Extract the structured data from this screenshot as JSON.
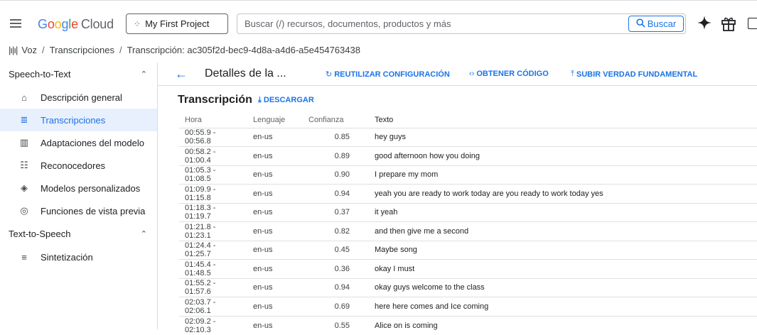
{
  "topbar": {
    "logo_parts": [
      "G",
      "o",
      "o",
      "g",
      "l",
      "e"
    ],
    "logo_suffix": "Cloud",
    "project": "My First Project",
    "search_placeholder": "Buscar (/) recursos, documentos, productos y más",
    "search_button": "Buscar",
    "icons": [
      "menu-icon",
      "project-dots-icon",
      "search-icon",
      "gemini-spark-icon",
      "gift-icon",
      "terminal-icon"
    ]
  },
  "breadcrumb": {
    "items": [
      "Voz",
      "Transcripciones",
      "Transcripción: ac305f2d-bec9-4d8a-a4d6-a5e454763438"
    ]
  },
  "sidebar": {
    "sections": [
      {
        "label": "Speech-to-Text",
        "items": [
          {
            "label": "Descripción general",
            "icon": "home-icon",
            "glyph": "⌂"
          },
          {
            "label": "Transcripciones",
            "icon": "transcriptions-icon",
            "glyph": "≣",
            "active": true
          },
          {
            "label": "Adaptaciones del modelo",
            "icon": "model-adaptation-icon",
            "glyph": "▥"
          },
          {
            "label": "Reconocedores",
            "icon": "recognizers-icon",
            "glyph": "☷"
          },
          {
            "label": "Modelos personalizados",
            "icon": "custom-models-icon",
            "glyph": "◈"
          },
          {
            "label": "Funciones de vista previa",
            "icon": "preview-features-icon",
            "glyph": "◎"
          }
        ]
      },
      {
        "label": "Text-to-Speech",
        "items": [
          {
            "label": "Sintetización",
            "icon": "synthesis-icon",
            "glyph": "≡"
          }
        ]
      }
    ]
  },
  "main": {
    "title": "Detalles de la ...",
    "actions": [
      "REUTILIZAR CONFIGURACIÓN",
      "OBTENER CÓDIGO",
      "SUBIR VERDAD FUNDAMENTAL"
    ],
    "section_title": "Transcripción",
    "download": "DESCARGAR",
    "columns": [
      "Hora",
      "Lenguaje",
      "Confianza",
      "Texto"
    ],
    "rows": [
      [
        "00:55.9 - 00:56.8",
        "en-us",
        "0.85",
        "hey guys"
      ],
      [
        "00:58.2 - 01:00.4",
        "en-us",
        "0.89",
        "good afternoon how you doing"
      ],
      [
        "01:05.3 - 01:08.5",
        "en-us",
        "0.90",
        "I prepare my mom"
      ],
      [
        "01:09.9 - 01:15.8",
        "en-us",
        "0.94",
        "yeah you are ready to work today are you ready to work today yes"
      ],
      [
        "01:18.3 - 01:19.7",
        "en-us",
        "0.37",
        "it yeah"
      ],
      [
        "01:21.8 - 01:23.1",
        "en-us",
        "0.82",
        "and then give me a second"
      ],
      [
        "01:24.4 - 01:25.7",
        "en-us",
        "0.45",
        "Maybe song"
      ],
      [
        "01:45.4 - 01:48.5",
        "en-us",
        "0.36",
        "okay I must"
      ],
      [
        "01:55.2 - 01:57.6",
        "en-us",
        "0.94",
        "okay guys welcome to the class"
      ],
      [
        "02:03.7 - 02:06.1",
        "en-us",
        "0.69",
        "here here comes and Ice coming"
      ],
      [
        "02:09.2 - 02:10.3",
        "en-us",
        "0.55",
        "Alice on is coming"
      ]
    ]
  },
  "colors": {
    "accent": "#1a73e8",
    "active_bg": "#e8f0fe"
  }
}
